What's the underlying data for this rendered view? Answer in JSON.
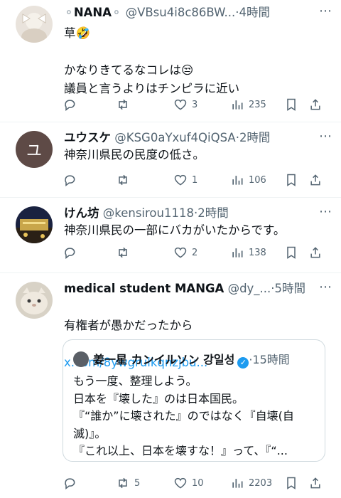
{
  "tweets": [
    {
      "name": "NANA",
      "handle": "@VBsu4i8c86BW...",
      "time": "4時間",
      "text": "草🤣\n\nかなりきてるなコレは😒\n議員と言うよりはチンピラに近い",
      "replies": "",
      "retweets": "",
      "likes": "3",
      "views": "235"
    },
    {
      "name": "ユウスケ",
      "handle": "@KSG0aYxuf4QiQSA",
      "time": "2時間",
      "avatar_letter": "ユ",
      "text": "神奈川県民の民度の低さ。",
      "likes": "1",
      "views": "106"
    },
    {
      "name": "けん坊",
      "handle": "@kensirou1118",
      "time": "2時間",
      "text": "神奈川県民の一部にバカがいたからです。",
      "likes": "2",
      "views": "138"
    },
    {
      "name": "medical student MANGA",
      "handle": "@dy_...",
      "time": "5時間",
      "text": "有権者が愚かだったから",
      "link": "x.com/8ywgrulkqnzjbu...",
      "retweets": "5",
      "likes": "10",
      "views": "2203",
      "quote": {
        "name": "姜一星 カンイルソン 강일성",
        "time": "15時間",
        "text": "もう一度、整理しよう。\n日本を『壊した』のは日本国民。\n『“誰か”に壊された』のではなく『自壊(自滅)』。\n『これ以上、日本を壊すな！』って、『“..."
      }
    }
  ],
  "icons": [
    "reply-icon",
    "retweet-icon",
    "like-icon",
    "views-icon",
    "bookmark-icon",
    "share-icon",
    "more-icon"
  ],
  "colors": {
    "link": "#1d9bf0",
    "secondary": "#536471",
    "divider": "#eff3f4"
  }
}
